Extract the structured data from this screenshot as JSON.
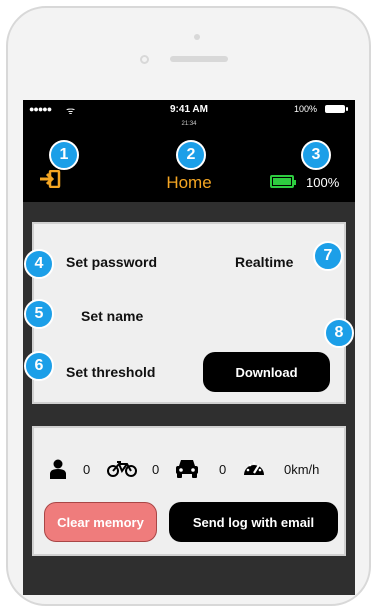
{
  "status_bar": {
    "signal": "●●●●●",
    "wifi": "ᯤ",
    "time": "9:41 AM",
    "sub_time": "21:34",
    "battery": "100%"
  },
  "header": {
    "title": "Home",
    "battery_percent": "100%",
    "title_color": "#f5a623",
    "battery_color": "#2ecc40"
  },
  "badges": [
    "1",
    "2",
    "3",
    "4",
    "5",
    "6",
    "7",
    "8"
  ],
  "badge_color": "#1c9fe8",
  "settings": {
    "set_password": "Set password",
    "set_name": "Set name",
    "set_threshold": "Set threshold",
    "realtime": "Realtime",
    "download": "Download"
  },
  "counters": {
    "person": "0",
    "bike": "0",
    "car": "0",
    "speed": "0km/h",
    "icons": [
      "person-icon",
      "bicycle-icon",
      "car-icon",
      "speedometer-icon"
    ]
  },
  "actions": {
    "clear_memory": "Clear memory",
    "send_log": "Send log with email",
    "clear_color": "#ef7c7c"
  }
}
